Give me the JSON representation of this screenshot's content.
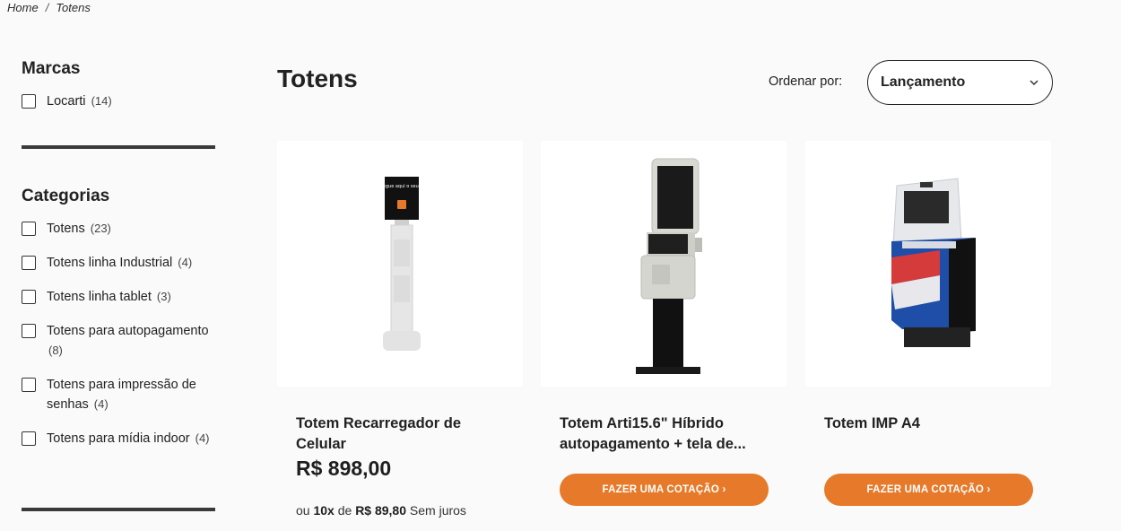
{
  "breadcrumb": {
    "home": "Home",
    "separator": "/",
    "current": "Totens"
  },
  "sidebar": {
    "brands_title": "Marcas",
    "brands": [
      {
        "label": "Locarti",
        "count": "(14)"
      }
    ],
    "categories_title": "Categorias",
    "categories": [
      {
        "label": "Totens",
        "count": "(23)"
      },
      {
        "label": "Totens linha Industrial",
        "count": "(4)"
      },
      {
        "label": "Totens linha tablet",
        "count": "(3)"
      },
      {
        "label": "Totens para autopagamento",
        "count": "(8)"
      },
      {
        "label": "Totens para impressão de senhas",
        "count": "(4)"
      },
      {
        "label": "Totens para mídia indoor",
        "count": "(4)"
      }
    ]
  },
  "header": {
    "title": "Totens",
    "sort_label": "Ordenar por:",
    "sort_value": "Lançamento"
  },
  "products": [
    {
      "name": "Totem Recarregador de Celular",
      "price": "R$ 898,00",
      "install_prefix": "ou",
      "install_times": "10x",
      "install_mid": "de",
      "install_value": "R$ 89,80",
      "install_suffix": "Sem juros",
      "screen_text": "Recarregue aqui o seu celular"
    },
    {
      "name": "Totem Arti15.6\" Híbrido autopagamento + tela de...",
      "button": "FAZER UMA COTAÇÃO ›"
    },
    {
      "name": "Totem IMP A4",
      "button": "FAZER UMA COTAÇÃO ›"
    }
  ],
  "colors": {
    "accent": "#e67a2a",
    "divider": "#3a3a3a",
    "kiosk_blue": "#1f4ea8",
    "kiosk_red": "#d63b3b"
  }
}
